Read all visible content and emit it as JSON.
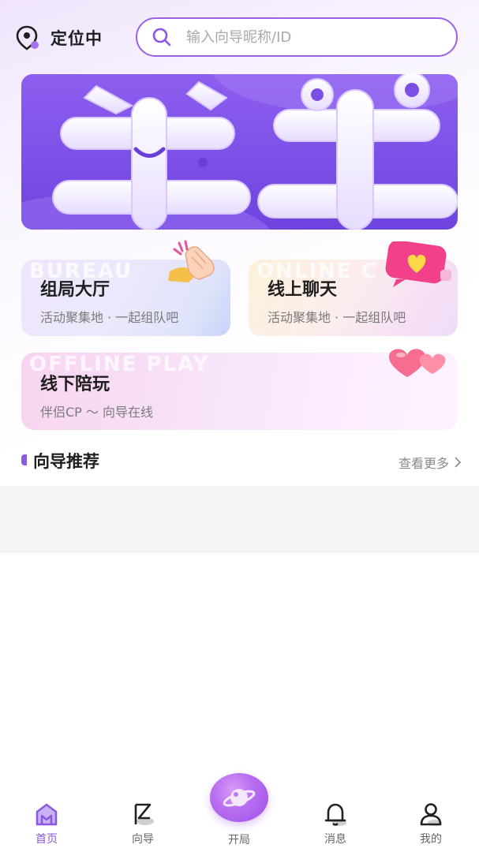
{
  "header": {
    "location_label": "定位中",
    "search_placeholder": "输入向导昵称/ID"
  },
  "cards": {
    "lobby": {
      "watermark": "BUREAU",
      "title": "组局大厅",
      "subtitle": "活动聚集地 · 一起组队吧"
    },
    "chat": {
      "watermark": "ONLINE C",
      "title": "线上聊天",
      "subtitle": "活动聚集地 · 一起组队吧"
    },
    "offline": {
      "watermark": "OFFLINE PLAY",
      "title": "线下陪玩",
      "subtitle": "伴侣CP ～ 向导在线"
    }
  },
  "section": {
    "title": "向导推荐",
    "more_label": "查看更多"
  },
  "tabbar": {
    "items": [
      {
        "label": "首页",
        "icon": "home-icon",
        "active": true
      },
      {
        "label": "向导",
        "icon": "guide-icon",
        "active": false
      },
      {
        "label": "开局",
        "icon": "planet-icon",
        "active": false
      },
      {
        "label": "消息",
        "icon": "bell-icon",
        "active": false
      },
      {
        "label": "我的",
        "icon": "user-icon",
        "active": false
      }
    ]
  },
  "colors": {
    "accent": "#8b59e4",
    "banner": "#7b4fe6",
    "search_border": "#9b62e8"
  }
}
